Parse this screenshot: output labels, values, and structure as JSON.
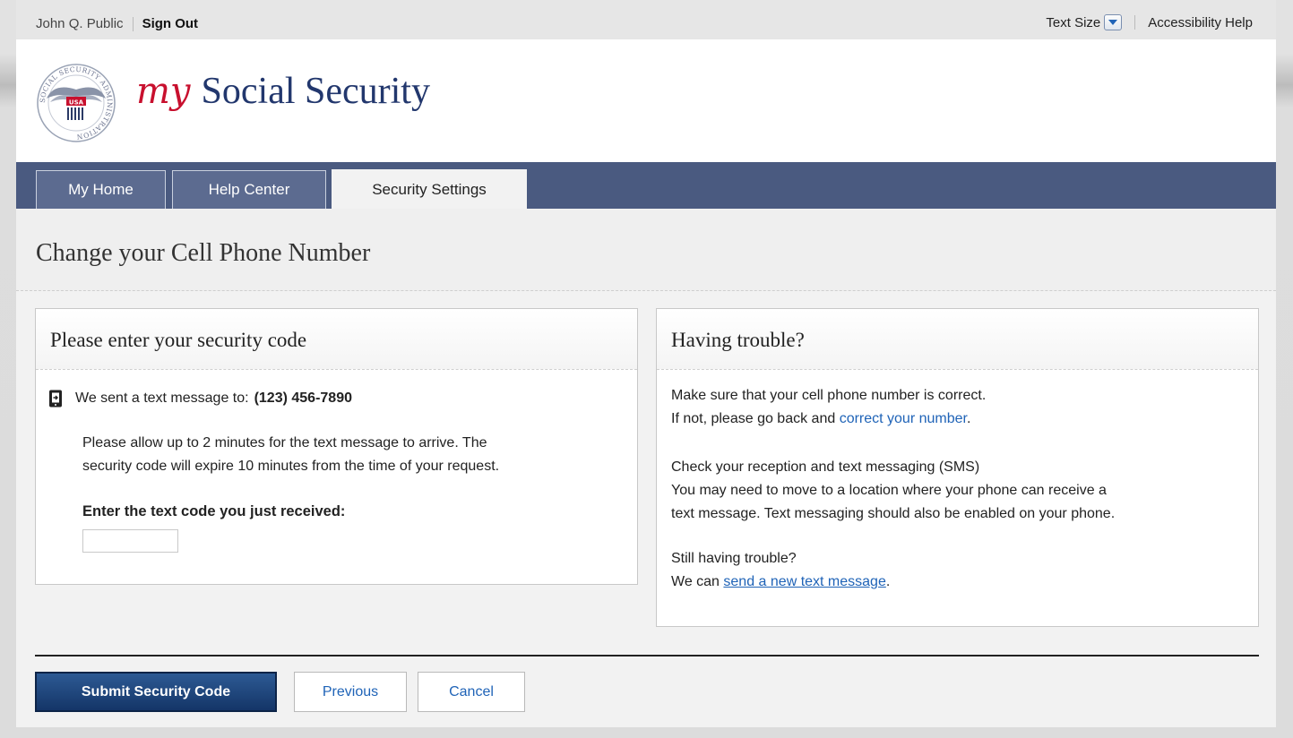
{
  "util": {
    "user_name": "John Q. Public",
    "sign_out": "Sign Out",
    "text_size": "Text Size",
    "accessibility_help": "Accessibility Help"
  },
  "brand": {
    "my": "my",
    "name": "Social Security",
    "seal_text": "SOCIAL SECURITY ADMINISTRATION",
    "seal_usa": "USA"
  },
  "nav": {
    "tabs": [
      {
        "label": "My Home"
      },
      {
        "label": "Help Center"
      },
      {
        "label": "Security Settings"
      }
    ]
  },
  "page_title": "Change your Cell Phone Number",
  "left_panel": {
    "heading": "Please enter your security code",
    "sent_label": "We sent a text message to:",
    "phone_number": "(123) 456-7890",
    "allow_text_line1": "Please allow up to 2 minutes for the text message to arrive. The",
    "allow_text_line2": "security code will expire 10 minutes from the time of your request.",
    "code_label": "Enter the text code you just received:",
    "code_value": ""
  },
  "right_panel": {
    "heading": "Having trouble?",
    "p1_line1": "Make sure that your cell phone number is correct.",
    "p1_line2_pre": "If not, please go back and ",
    "p1_link": "correct your number",
    "p1_line2_post": ".",
    "p2_line1": "Check your reception and text messaging (SMS)",
    "p2_line2": "You may need to move to a location where your phone can receive a",
    "p2_line3": "text message. Text messaging should also be enabled on your phone.",
    "p3_line1": "Still having trouble?",
    "p3_line2_pre": "We can ",
    "p3_link": "send a new text message",
    "p3_line2_post": "."
  },
  "buttons": {
    "submit": "Submit Security Code",
    "previous": "Previous",
    "cancel": "Cancel"
  },
  "colors": {
    "nav_bar": "#4a5a80",
    "brand_red": "#c8102e",
    "brand_navy": "#22376d",
    "link": "#1f63b7",
    "primary_button": "#143567"
  }
}
